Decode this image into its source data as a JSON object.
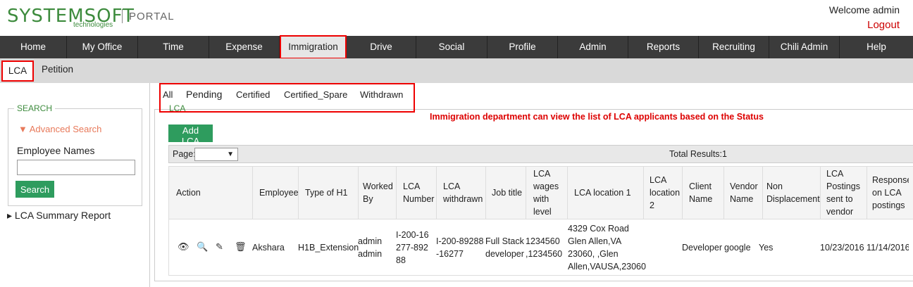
{
  "header": {
    "logo": "SYSTEMSOFT",
    "logo_sub": "technologies",
    "portal": "PORTAL",
    "welcome": "Welcome admin",
    "logout": "Logout"
  },
  "nav": [
    "Home",
    "My Office",
    "Time",
    "Expense",
    "Immigration",
    "Drive",
    "Social",
    "Profile",
    "Admin",
    "Reports",
    "Recruiting",
    "Chili Admin",
    "Help"
  ],
  "subnav": {
    "lca": "LCA",
    "petition": "Petition"
  },
  "sidebar": {
    "legend": "SEARCH",
    "advanced": "▼ Advanced Search",
    "employee_label": "Employee Names",
    "search_button": "Search",
    "summary": "LCA Summary Report"
  },
  "status_tabs": {
    "all": "All",
    "pending": "Pending",
    "certified": "Certified",
    "certified_spare": "Certified_Spare",
    "withdrawn": "Withdrawn"
  },
  "lca_legend": "LCA",
  "annotation": "Immigration department can view the list of LCA applicants based on the Status",
  "add_lca": "Add LCA",
  "pager": {
    "label": "Page:",
    "total": "Total Results:1"
  },
  "table": {
    "headers": {
      "action": "Action",
      "employee": "Employee",
      "type_h1": "Type of H1",
      "worked_by": "Worked By",
      "lca_number": "LCA Number",
      "lca_withdrawn": "LCA withdrawn",
      "job_title": "Job title",
      "lca_wages": "LCA wages with level",
      "lca_loc1": "LCA location 1",
      "lca_loc2": "LCA location 2",
      "client": "Client Name",
      "vendor": "Vendor Name",
      "non_disp": "Non Displacement",
      "postings_vendor": "LCA Postings sent to vendor",
      "response": "Response on LCA postings"
    },
    "row": {
      "employee": "Akshara",
      "type_h1": "H1B_Extension",
      "worked_by": "admin admin",
      "lca_number": "I-200-16277-89288",
      "lca_withdrawn": "I-200-89288-16277",
      "job_title": "Full Stack developer",
      "lca_wages": "1234560 ,1234560",
      "lca_loc1": "4329 Cox Road Glen Allen,VA 23060, ,Glen Allen,VAUSA,23060",
      "lca_loc2": "",
      "client": "Developer",
      "vendor": "google",
      "non_disp": "Yes",
      "postings_vendor": "10/23/2016",
      "response": "11/14/2016"
    }
  }
}
